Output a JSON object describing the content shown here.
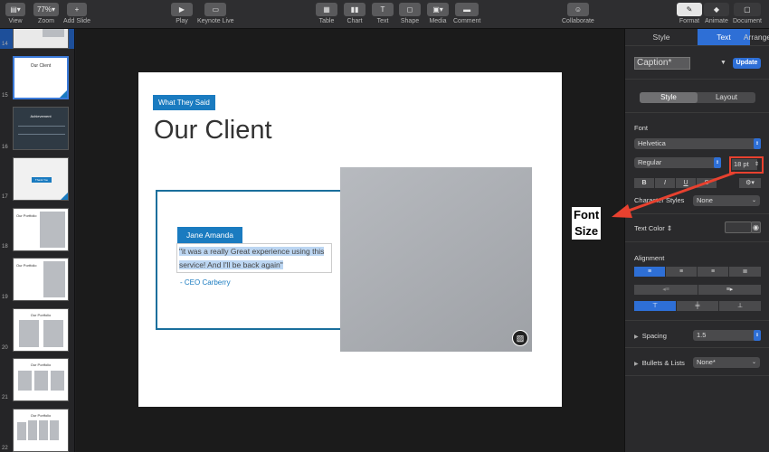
{
  "toolbar": {
    "view": "View",
    "zoom_value": "77%",
    "zoom": "Zoom",
    "add_slide": "Add Slide",
    "play": "Play",
    "keynote_live": "Keynote Live",
    "table": "Table",
    "chart": "Chart",
    "text": "Text",
    "shape": "Shape",
    "media": "Media",
    "comment": "Comment",
    "collaborate": "Collaborate",
    "format": "Format",
    "animate": "Animate",
    "document": "Document"
  },
  "navigator": {
    "slide_numbers": [
      "14",
      "15",
      "16",
      "17",
      "18",
      "19",
      "20",
      "21",
      "22"
    ],
    "thumb_titles": [
      "",
      "Our Client",
      "Achievement",
      "Thank You",
      "Our Portfolio",
      "Our Portfolio",
      "Our Portfolio",
      "Our Portfolio",
      "Our Portfolio"
    ]
  },
  "slide": {
    "tag": "What They Said",
    "title": "Our Client",
    "name": "Jane Amanda",
    "quote_line1": "\"it was a really Great experience using this",
    "quote_line2": "service! And I'll be back again\"",
    "cite": "- CEO Carberry"
  },
  "inspector": {
    "tabs": [
      "Style",
      "Text",
      "Arrange"
    ],
    "paragraph_style": "Caption*",
    "update": "Update",
    "seg_style": "Style",
    "seg_layout": "Layout",
    "font_label": "Font",
    "font_family": "Helvetica",
    "font_weight": "Regular",
    "font_size": "18 pt",
    "char_styles_label": "Character Styles",
    "char_styles_value": "None",
    "text_color_label": "Text Color",
    "alignment_label": "Alignment",
    "spacing_label": "Spacing",
    "spacing_value": "1.5",
    "bullets_label": "Bullets & Lists",
    "bullets_value": "None*"
  },
  "annotation": {
    "line1": "Font",
    "line2": "Size"
  },
  "colors": {
    "accent": "#1a7bc0",
    "selection": "#2e6fd6",
    "annotation": "#e8412f"
  }
}
